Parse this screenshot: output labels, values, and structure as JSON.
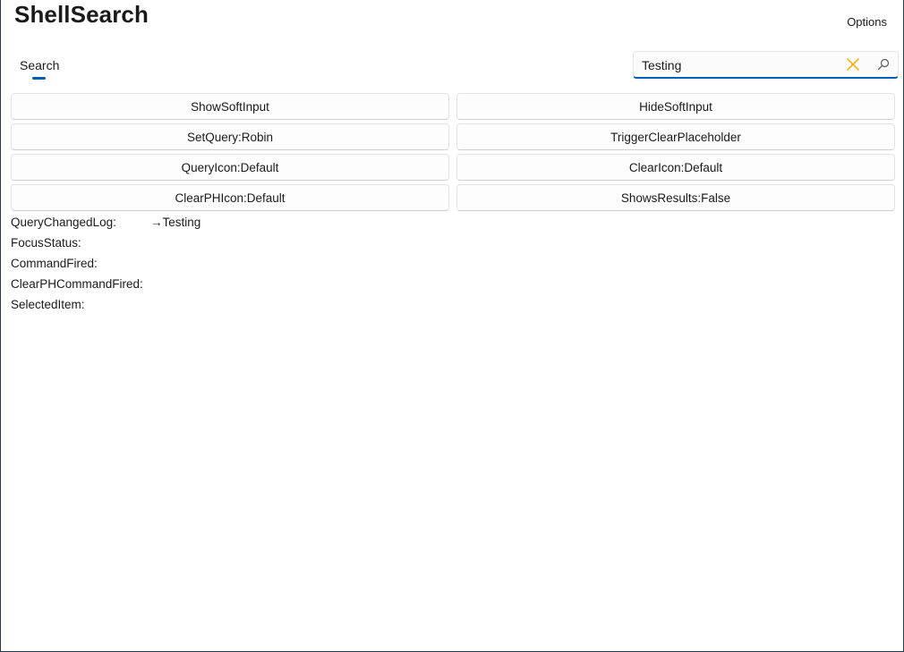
{
  "app": {
    "title": "ShellSearch",
    "options_label": "Options"
  },
  "tabs": [
    {
      "label": "Search",
      "selected": true
    }
  ],
  "search": {
    "value": "Testing",
    "placeholder": "",
    "clear_icon": "close-icon",
    "query_icon": "search-icon",
    "clear_icon_color": "#f2b01e",
    "accent_color": "#005fb8"
  },
  "buttons": [
    {
      "label": "ShowSoftInput"
    },
    {
      "label": "HideSoftInput"
    },
    {
      "label": "SetQuery:Robin"
    },
    {
      "label": "TriggerClearPlaceholder"
    },
    {
      "label": "QueryIcon:Default"
    },
    {
      "label": "ClearIcon:Default"
    },
    {
      "label": "ClearPHIcon:Default"
    },
    {
      "label": "ShowsResults:False"
    }
  ],
  "log": [
    {
      "label": "QueryChangedLog:",
      "value": "→Testing"
    },
    {
      "label": "FocusStatus:",
      "value": ""
    },
    {
      "label": "CommandFired:",
      "value": ""
    },
    {
      "label": "ClearPHCommandFired:",
      "value": ""
    },
    {
      "label": "SelectedItem:",
      "value": ""
    }
  ]
}
